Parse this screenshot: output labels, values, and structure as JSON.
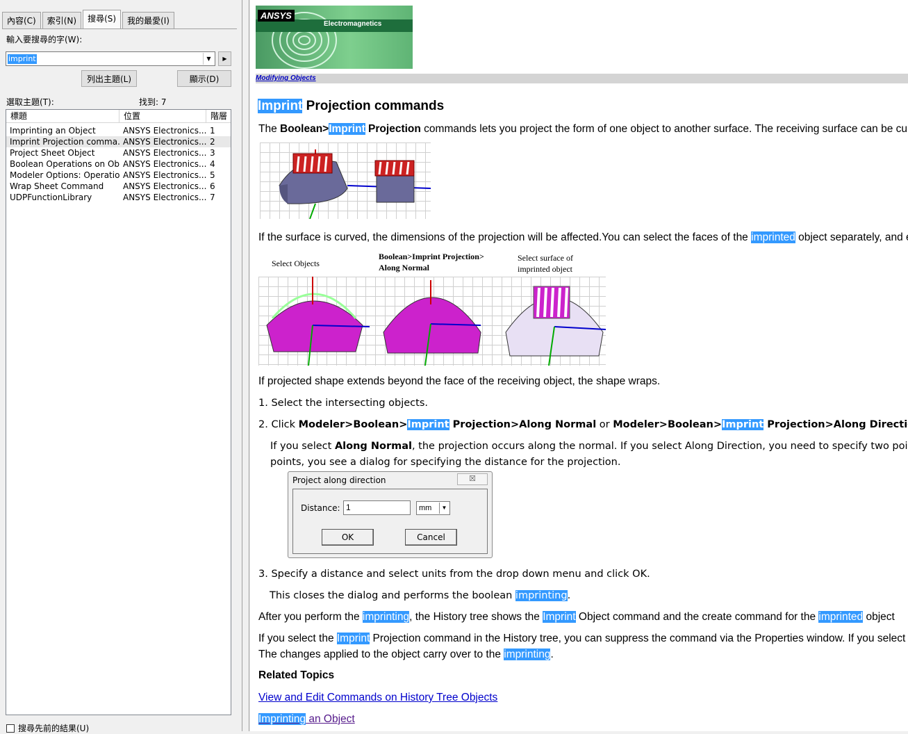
{
  "nav": {
    "tabs": [
      "內容(C)",
      "索引(N)",
      "搜尋(S)",
      "我的最愛(I)"
    ],
    "active_tab": 2,
    "search_label": "輸入要搜尋的字(W):",
    "search_value": "imprint",
    "list_topics_button": "列出主題(L)",
    "display_button": "顯示(D)",
    "select_topic_label": "選取主題(T):",
    "found_label": "找到: 7",
    "columns": [
      "標題",
      "位置",
      "階層"
    ],
    "rows": [
      {
        "title": "Imprinting an Object",
        "location": "ANSYS Electronics...",
        "rank": "1"
      },
      {
        "title": "Imprint Projection comma...",
        "location": "ANSYS Electronics...",
        "rank": "2"
      },
      {
        "title": "Project Sheet Object",
        "location": "ANSYS Electronics...",
        "rank": "3"
      },
      {
        "title": "Boolean Operations on Ob...",
        "location": "ANSYS Electronics...",
        "rank": "4"
      },
      {
        "title": "Modeler Options: Operatio...",
        "location": "ANSYS Electronics...",
        "rank": "5"
      },
      {
        "title": "Wrap Sheet Command",
        "location": "ANSYS Electronics...",
        "rank": "6"
      },
      {
        "title": "UDPFunctionLibrary",
        "location": "ANSYS Electronics...",
        "rank": "7"
      }
    ],
    "selected_row": 1,
    "prev_results_label": "搜尋先前的結果(U)"
  },
  "content": {
    "banner_logo": "ANSYS",
    "banner_product": "Electromagnetics",
    "breadcrumb": "Modifying Objects",
    "title_hl": "Imprint",
    "title_rest": " Projection commands",
    "p1": {
      "a": "The ",
      "b1": "Boolean>",
      "hl": "Imprint",
      "b2": " Projection",
      "c": " commands lets you project the form of one object to another surface. The receiving surface can be cu"
    },
    "p2": {
      "a": "If the surface is curved, the dimensions of the projection will be affected.You can select the faces of the ",
      "hl": "imprinted",
      "c": " object separately, and e"
    },
    "fig2_captions": [
      "Select Objects",
      "Boolean>Imprint Projection>",
      "Along Normal",
      "Select surface of",
      "imprinted object"
    ],
    "p3": "If projected shape extends beyond the face of the receiving object, the shape wraps.",
    "step1": "1. Select the intersecting objects.",
    "step2": {
      "a": "2. Click ",
      "b1": "Modeler>Boolean>",
      "hl1": "Imprint",
      "b2": " Projection>Along Normal",
      "or": " or ",
      "b3": "Modeler>Boolean>",
      "hl2": "Imprint",
      "b4": " Projection>Along Direction..."
    },
    "step2_note": {
      "a": "If you select ",
      "b": "Along Normal",
      "c": ", the projection occurs along the normal. If you select Along Direction, you need to specify two point",
      "line2": "points, you see a dialog for specifying the distance for the projection."
    },
    "dialog": {
      "title": "Project along direction",
      "close": "☒",
      "distance_label": "Distance:",
      "distance_value": "1",
      "unit": "mm",
      "ok": "OK",
      "cancel": "Cancel"
    },
    "step3": "3. Specify a distance and select units from the drop down menu and click OK.",
    "step3_note": {
      "a": "This closes the dialog and performs the boolean ",
      "hl": "imprinting",
      "c": "."
    },
    "p4": {
      "a": "After you perform the ",
      "hl1": "imprinting",
      "b": ", the History tree shows the ",
      "hl2": "Imprint",
      "c": " Object command and the create command for the ",
      "hl3": "imprinted",
      "d": " object"
    },
    "p5": {
      "a": "If you select the ",
      "hl": "Imprint",
      "b": " Projection command in the History tree, you can suppress the command via the Properties window. If you select th",
      "line2a": "The changes applied to the object carry over to the ",
      "line2hl": "imprinting",
      "line2c": "."
    },
    "related_heading": "Related Topics",
    "link1": "View and Edit Commands on History Tree Objects",
    "link2_hl": "Imprinting",
    "link2_rest": " an Object"
  }
}
